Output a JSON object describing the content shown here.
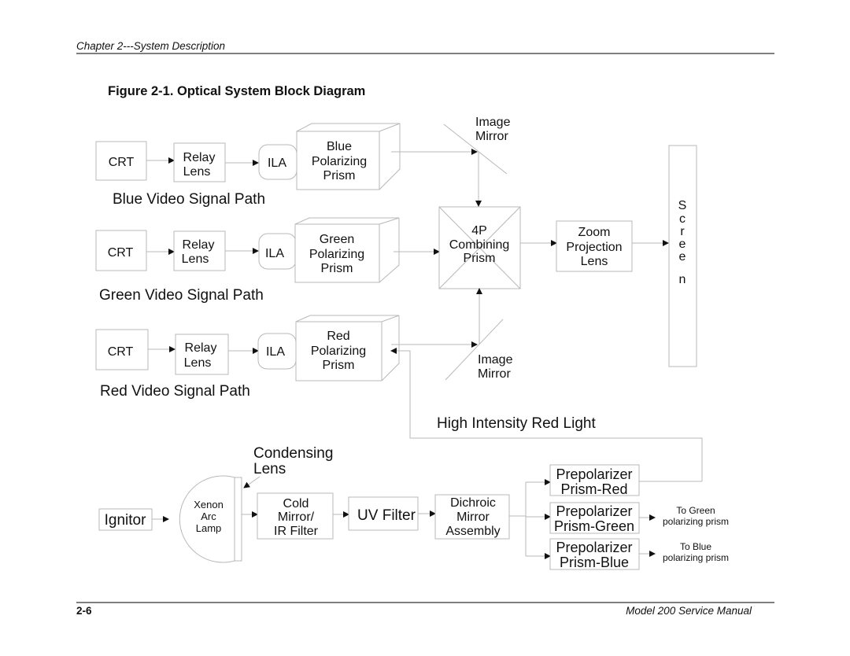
{
  "page": {
    "header": "Chapter 2---System Description",
    "footer_left": "2-6",
    "footer_right": "Model 200 Service Manual"
  },
  "figure": {
    "title": "Figure 2-1.  Optical System Block Diagram"
  },
  "blue_path": {
    "crt": "CRT",
    "relay": [
      "Relay",
      "Lens"
    ],
    "ila": "ILA",
    "prism": [
      "Blue",
      "Polarizing",
      "Prism"
    ],
    "caption": "Blue Video Signal Path"
  },
  "green_path": {
    "crt": "CRT",
    "relay": [
      "Relay",
      "Lens"
    ],
    "ila": "ILA",
    "prism": [
      "Green",
      "Polarizing",
      "Prism"
    ],
    "caption": "Green Video Signal Path"
  },
  "red_path": {
    "crt": "CRT",
    "relay": [
      "Relay",
      "Lens"
    ],
    "ila": "ILA",
    "prism": [
      "Red",
      "Polarizing",
      "Prism"
    ],
    "caption": "Red Video Signal Path"
  },
  "mirrors": {
    "top": [
      "Image",
      "Mirror"
    ],
    "bottom": [
      "Image",
      "Mirror"
    ]
  },
  "combining_prism": [
    "4P",
    "Combining",
    "Prism"
  ],
  "zoom_lens": [
    "Zoom",
    "Projection",
    "Lens"
  ],
  "screen": [
    "S",
    "c",
    "r",
    "e",
    "e",
    "n"
  ],
  "red_light_label": "High Intensity Red Light",
  "illumination": {
    "ignitor": "Ignitor",
    "lamp": [
      "Xenon",
      "Arc",
      "Lamp"
    ],
    "condensing": [
      "Condensing",
      "Lens"
    ],
    "cold_mirror": [
      "Cold",
      "Mirror/",
      "IR Filter"
    ],
    "uv_filter": "UV Filter",
    "dichroic": [
      "Dichroic",
      "Mirror",
      "Assembly"
    ],
    "prepolarizers": [
      {
        "line1": "Prepolarizer",
        "line2": "Prism-Red"
      },
      {
        "line1": "Prepolarizer",
        "line2": "Prism-Green",
        "dest": [
          "To Green",
          "polarizing prism"
        ]
      },
      {
        "line1": "Prepolarizer",
        "line2": "Prism-Blue",
        "dest": [
          "To Blue",
          "polarizing prism"
        ]
      }
    ]
  }
}
